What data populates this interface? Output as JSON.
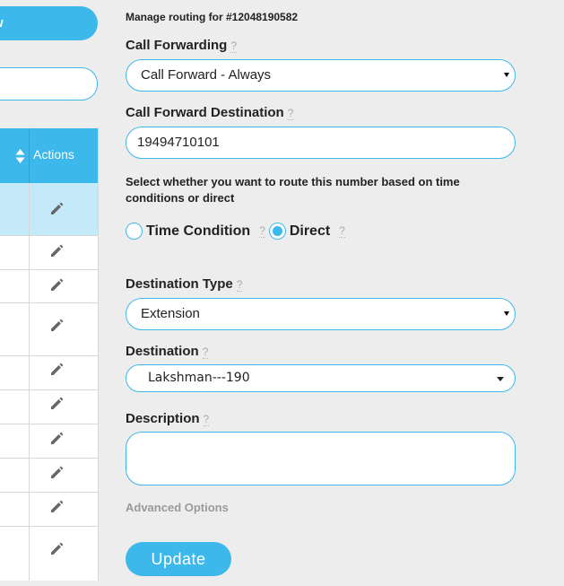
{
  "left_panel": {
    "new_button_label": "w",
    "table": {
      "header_actions": "Actions",
      "rows": 10
    }
  },
  "form": {
    "title": "Manage routing for #12048190582",
    "call_forwarding": {
      "label": "Call Forwarding",
      "help": "?",
      "value": "Call Forward - Always"
    },
    "call_forward_destination": {
      "label": "Call Forward Destination",
      "help": "?",
      "value": "19494710101"
    },
    "route_instruction": "Select whether you want to route this number based on time conditions or direct",
    "routing_options": {
      "time_condition": "Time Condition",
      "direct": "Direct",
      "help": "?",
      "selected": "direct"
    },
    "destination_type": {
      "label": "Destination Type",
      "help": "?",
      "value": "Extension"
    },
    "destination": {
      "label": "Destination",
      "help": "?",
      "value": "Lakshman---190"
    },
    "description": {
      "label": "Description",
      "help": "?",
      "value": ""
    },
    "advanced_options": "Advanced Options",
    "update_button": "Update"
  },
  "colors": {
    "accent": "#3db8ea",
    "background": "#ededed",
    "selected_row": "#c4e9f8",
    "muted": "#9a9a9a"
  }
}
